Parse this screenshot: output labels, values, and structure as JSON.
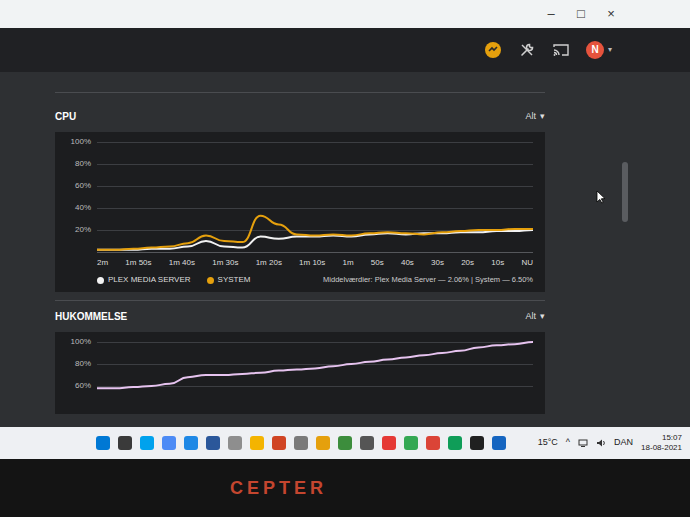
{
  "window": {
    "controls": [
      "–",
      "□",
      "×"
    ]
  },
  "header": {
    "avatar": "N",
    "avatar_caret": "▾"
  },
  "cpu": {
    "title": "CPU",
    "range": "Alt",
    "range_caret": "▾",
    "y_ticks": [
      "100%",
      "80%",
      "60%",
      "40%",
      "20%"
    ],
    "x_ticks": [
      "2m",
      "1m 50s",
      "1m 40s",
      "1m 30s",
      "1m 20s",
      "1m 10s",
      "1m",
      "50s",
      "40s",
      "30s",
      "20s",
      "10s",
      "NU"
    ],
    "series": [
      {
        "name": "PLEX MEDIA SERVER",
        "color": "#f2f2f2",
        "values": [
          2,
          2,
          2,
          3,
          3,
          5,
          10,
          5,
          4,
          14,
          12,
          14,
          14,
          15,
          14,
          16,
          17,
          16,
          17,
          17,
          18,
          18,
          19,
          19,
          20
        ]
      },
      {
        "name": "SYSTEM",
        "color": "#e5a00d",
        "values": [
          2,
          2,
          3,
          4,
          5,
          8,
          15,
          10,
          9,
          33,
          25,
          16,
          15,
          16,
          15,
          17,
          18,
          17,
          16,
          18,
          19,
          20,
          20,
          21,
          21
        ]
      }
    ],
    "averages": "Middelværdier: Plex Media Server — 2.06% | System — 6.50%"
  },
  "memory": {
    "title": "HUKOMMELSE",
    "range": "Alt",
    "range_caret": "▾",
    "y_ticks": [
      "100%",
      "80%",
      "60%"
    ],
    "series": [
      {
        "color": "#e6c3ef",
        "values": [
          58,
          58,
          59,
          60,
          62,
          68,
          70,
          70,
          71,
          72,
          74,
          75,
          76,
          78,
          80,
          82,
          84,
          86,
          88,
          90,
          92,
          95,
          97,
          98,
          100
        ]
      }
    ]
  },
  "taskbar": {
    "apps": [
      {
        "color": "#0078d4"
      },
      {
        "color": "#3a3a3a"
      },
      {
        "color": "#00a2ed"
      },
      {
        "color": "#4c8bf5"
      },
      {
        "color": "#1e88e5"
      },
      {
        "color": "#2b579a"
      },
      {
        "color": "#8e8e8e"
      },
      {
        "color": "#f4b400"
      },
      {
        "color": "#d04423"
      },
      {
        "color": "#7a7a7a"
      },
      {
        "color": "#e5a00d"
      },
      {
        "color": "#3c8d3c"
      },
      {
        "color": "#555555"
      },
      {
        "color": "#e53935"
      },
      {
        "color": "#34a853"
      },
      {
        "color": "#db4437"
      },
      {
        "color": "#0f9d58"
      },
      {
        "color": "#202020"
      },
      {
        "color": "#1565c0"
      }
    ],
    "weather": "15°C",
    "tray_caret": "^",
    "language": "DAN",
    "time": "15:07",
    "date": "18-08-2021"
  },
  "bezel": {
    "logo": "CEPTER"
  }
}
